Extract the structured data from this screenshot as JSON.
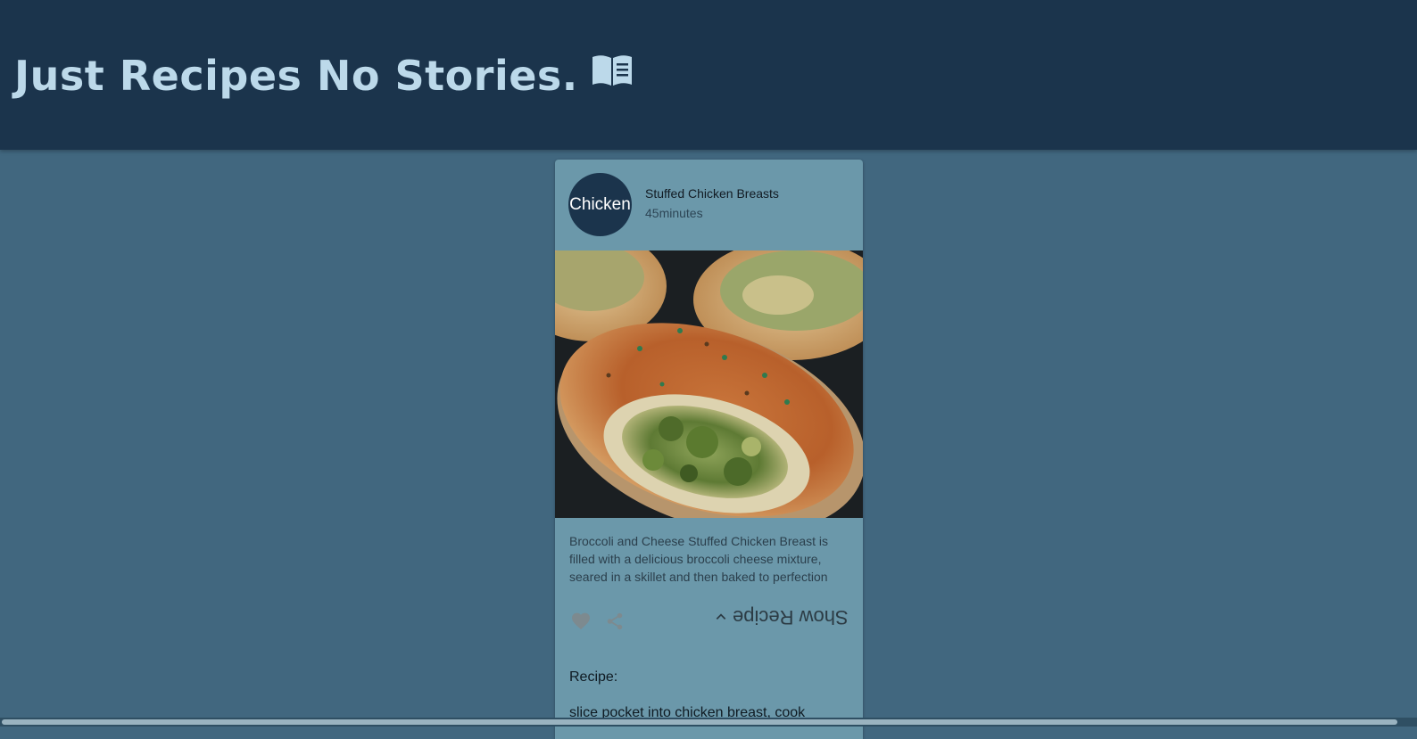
{
  "header": {
    "title": "Just Recipes No Stories.",
    "icon": "book-open-icon",
    "background": "#1b344c",
    "title_color": "#bcd9ea"
  },
  "card": {
    "avatar_text": "Chicken",
    "title": "Stuffed Chicken Breasts",
    "subheader": "45minutes",
    "image_subject": "broccoli-cheese-stuffed-chicken-breast",
    "description": "Broccoli and Cheese Stuffed Chicken Breast is filled with a delicious broccoli cheese mixture, seared in a skillet and then baked to perfection",
    "actions": {
      "favorite_icon": "heart-icon",
      "share_icon": "share-icon",
      "show_recipe_label": "Show Recipe",
      "expand_icon": "chevron-down-icon"
    },
    "recipe_heading": "Recipe:",
    "recipe_step": "slice pocket into chicken breast, cook"
  },
  "colors": {
    "page_background": "#41677f",
    "card_background": "#6b98aa",
    "avatar_background": "#1b344c"
  }
}
